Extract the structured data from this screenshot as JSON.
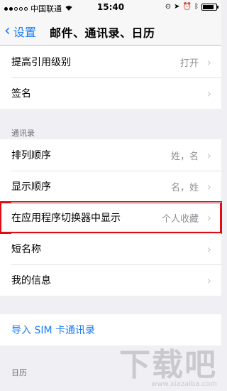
{
  "status": {
    "carrier": "中国联通",
    "time": "15:40",
    "battery_level": 0.85,
    "signal_bars_filled": 2,
    "signal_bars_total": 5
  },
  "nav": {
    "back_label": "设置",
    "title": "邮件、通讯录、日历"
  },
  "mail_rows": [
    {
      "label": "提高引用级别",
      "value": "打开"
    },
    {
      "label": "签名",
      "value": ""
    }
  ],
  "contacts": {
    "header": "通讯录",
    "rows": [
      {
        "label": "排列顺序",
        "value": "姓，名"
      },
      {
        "label": "显示顺序",
        "value": "名，姓"
      },
      {
        "label": "在应用程序切换器中显示",
        "value": "个人收藏"
      },
      {
        "label": "短名称",
        "value": ""
      },
      {
        "label": "我的信息",
        "value": ""
      }
    ]
  },
  "import": {
    "label": "导入 SIM 卡通讯录"
  },
  "calendar": {
    "header": "日历"
  },
  "watermark": {
    "main": "下载吧",
    "sub": "www.xiazaiba.com"
  },
  "colors": {
    "accent": "#1a7cf6",
    "highlight": "#e00b13",
    "background": "#efeff4"
  }
}
